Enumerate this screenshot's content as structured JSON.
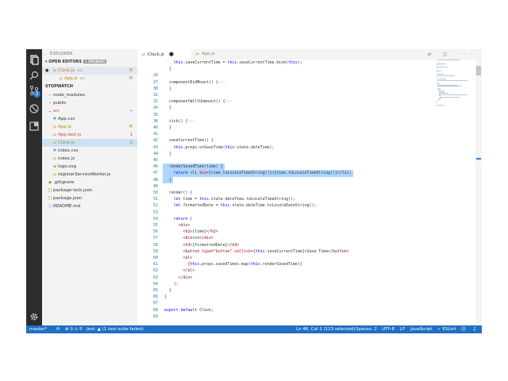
{
  "activity": {
    "icons": [
      "files-icon",
      "search-icon",
      "source-control-icon",
      "debug-icon",
      "extensions-icon",
      "gear-icon"
    ],
    "scm_badge": "2"
  },
  "sidebar": {
    "title": "EXPLORER",
    "open_editors_header": "▾ OPEN EDITORS",
    "unsaved_tag": "1 UNSAVED",
    "open_editors": [
      {
        "name": "Clock.js",
        "path": "src",
        "status": "M",
        "dirty": true
      },
      {
        "name": "App.js",
        "path": "src",
        "status": "M",
        "dirty": false
      }
    ],
    "project_header": "STOPWATCH",
    "tree": [
      {
        "name": "node_modules",
        "kind": "folder-closed",
        "depth": 1,
        "status": ""
      },
      {
        "name": "public",
        "kind": "folder-closed",
        "depth": 1,
        "status": ""
      },
      {
        "name": "src",
        "kind": "folder-open",
        "depth": 1,
        "status": "•"
      },
      {
        "name": "App.css",
        "kind": "css",
        "depth": 2,
        "status": ""
      },
      {
        "name": "App.js",
        "kind": "js",
        "depth": 2,
        "status": "M"
      },
      {
        "name": "App.test.js",
        "kind": "js",
        "depth": 2,
        "status": "1"
      },
      {
        "name": "Clock.js",
        "kind": "js",
        "depth": 2,
        "status": "U"
      },
      {
        "name": "index.css",
        "kind": "css",
        "depth": 2,
        "status": ""
      },
      {
        "name": "index.js",
        "kind": "js",
        "depth": 2,
        "status": ""
      },
      {
        "name": "logo.svg",
        "kind": "svg",
        "depth": 2,
        "status": ""
      },
      {
        "name": "registerServiceWorker.js",
        "kind": "js",
        "depth": 2,
        "status": ""
      },
      {
        "name": ".gitignore",
        "kind": "git",
        "depth": 1,
        "status": ""
      },
      {
        "name": "package-lock.json",
        "kind": "json",
        "depth": 1,
        "status": ""
      },
      {
        "name": "package.json",
        "kind": "json",
        "depth": 1,
        "status": ""
      },
      {
        "name": "README.md",
        "kind": "md",
        "depth": 1,
        "status": ""
      }
    ]
  },
  "tabs": [
    {
      "label": "Clock.js",
      "active": true,
      "dirty": true
    },
    {
      "label": "App.js",
      "active": false,
      "dirty": false
    }
  ],
  "tab_actions": "⇄ ◫ ···",
  "editor": {
    "selected_lines": [
      46,
      47,
      48
    ],
    "cursor_line": 46,
    "lines": [
      {
        "n": "",
        "code": "    this.saveCurrentTime = this.saveCurrentTime.bind(this);"
      },
      {
        "n": "",
        "code": "  }"
      },
      {
        "n": "26",
        "code": ""
      },
      {
        "n": "27",
        "code": "  componentDidMount() {···"
      },
      {
        "n": "30",
        "code": "  }"
      },
      {
        "n": "31",
        "code": ""
      },
      {
        "n": "32",
        "code": "  componentWillUnmount() {···"
      },
      {
        "n": "34",
        "code": "  }"
      },
      {
        "n": "35",
        "code": ""
      },
      {
        "n": "36",
        "code": "  tick() {···"
      },
      {
        "n": "40",
        "code": "  }"
      },
      {
        "n": "41",
        "code": ""
      },
      {
        "n": "42",
        "code": "  saveCurrentTime() {"
      },
      {
        "n": "43",
        "code": "    this.props.onSaveTime(this.state.dateTime);"
      },
      {
        "n": "44",
        "code": "  }"
      },
      {
        "n": "45",
        "code": ""
      },
      {
        "n": "46",
        "code": "  renderSavedTime(time) {"
      },
      {
        "n": "47",
        "code": "    return <li key={time.toLocaleTimeString()}>{time.toLocaleTimeString()}</li>;"
      },
      {
        "n": "48",
        "code": "  }"
      },
      {
        "n": "49",
        "code": ""
      },
      {
        "n": "50",
        "code": "  render() {"
      },
      {
        "n": "51",
        "code": "    let time = this.state.dateTime.toLocaleTimeString();"
      },
      {
        "n": "52",
        "code": "    let formattedDate = this.state.dateTime.toLocaleDateString();"
      },
      {
        "n": "53",
        "code": ""
      },
      {
        "n": "54",
        "code": "    return ("
      },
      {
        "n": "55",
        "code": "      <div>"
      },
      {
        "n": "56",
        "code": "        <h2>{time}</h2>"
      },
      {
        "n": "57",
        "code": "        <div>on</div>"
      },
      {
        "n": "58",
        "code": "        <h3>{formattedDate}</h3>"
      },
      {
        "n": "59",
        "code": "        <button type=\"button\" onClick={this.saveCurrentTime}>Save Time</button>"
      },
      {
        "n": "60",
        "code": "        <ul>"
      },
      {
        "n": "61",
        "code": "          {this.props.savedTimes.map(this.renderSavedTime)}"
      },
      {
        "n": "62",
        "code": "        </ul>"
      },
      {
        "n": "63",
        "code": "      </div>"
      },
      {
        "n": "64",
        "code": "    );"
      },
      {
        "n": "65",
        "code": "  }"
      },
      {
        "n": "66",
        "code": "}"
      },
      {
        "n": "67",
        "code": ""
      },
      {
        "n": "68",
        "code": "export default Clock;"
      },
      {
        "n": "69",
        "code": ""
      }
    ]
  },
  "status": {
    "branch": "master*",
    "sync": "⟳",
    "problems": "⊗ 0 ⚠ 0",
    "jest": "Jest: ▲ (1 test suite failed)",
    "position": "Ln 46, Col 1 (113 selected)",
    "spaces": "Spaces: 2",
    "encoding": "UTF-8",
    "eol": "LF",
    "language": "JavaScript",
    "eslint": "✓ ESLint",
    "feedback": "☺",
    "bell": "♫"
  },
  "colors": {
    "activity_bar": "#2c2c2c",
    "sidebar": "#f3f3f3",
    "status_bar": "#1f6fc5",
    "selection": "#add6ff",
    "line_number": "#237893"
  }
}
